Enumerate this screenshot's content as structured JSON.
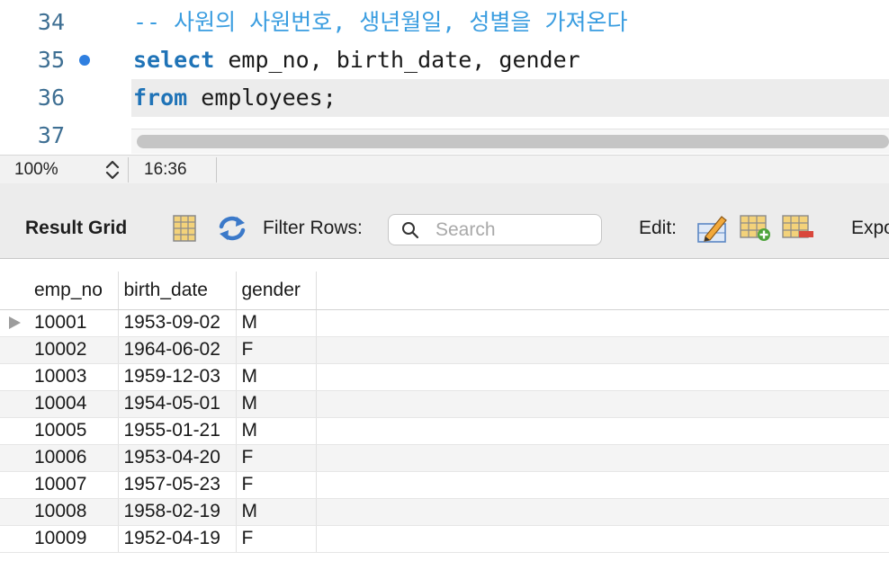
{
  "editor": {
    "lines": [
      {
        "number": "34",
        "text": "-- 사원의 사원번호, 생년월일, 성별을 가져온다"
      },
      {
        "number": "35",
        "keyword": "select",
        "rest": " emp_no, birth_date, gender"
      },
      {
        "number": "36",
        "keyword": "from",
        "rest": " employees;"
      },
      {
        "number": "37"
      }
    ],
    "colors": {
      "keyword": "#1f73b7",
      "comment": "#3a9de0",
      "line_number": "#3e6f93",
      "breakpoint": "#2f7fe0"
    }
  },
  "statusbar": {
    "zoom": "100%",
    "cursor_position": "16:36"
  },
  "toolbar": {
    "result_grid_label": "Result Grid",
    "filter_rows_label": "Filter Rows:",
    "search_placeholder": "Search",
    "edit_label": "Edit:",
    "export_label": "Expo",
    "icons": [
      "form-editor-icon",
      "refresh-icon",
      "search-icon",
      "edit-pencil-icon",
      "add-row-icon",
      "delete-row-icon"
    ]
  },
  "grid": {
    "columns": [
      "emp_no",
      "birth_date",
      "gender"
    ],
    "rows": [
      [
        "10001",
        "1953-09-02",
        "M"
      ],
      [
        "10002",
        "1964-06-02",
        "F"
      ],
      [
        "10003",
        "1959-12-03",
        "M"
      ],
      [
        "10004",
        "1954-05-01",
        "M"
      ],
      [
        "10005",
        "1955-01-21",
        "M"
      ],
      [
        "10006",
        "1953-04-20",
        "F"
      ],
      [
        "10007",
        "1957-05-23",
        "F"
      ],
      [
        "10008",
        "1958-02-19",
        "M"
      ],
      [
        "10009",
        "1952-04-19",
        "F"
      ]
    ]
  }
}
